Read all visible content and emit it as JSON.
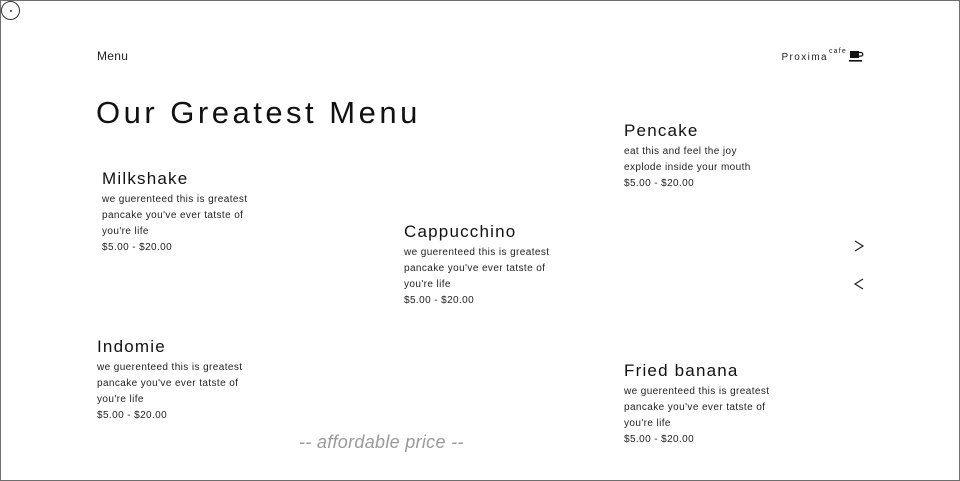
{
  "nav": {
    "menu_label": "Menu",
    "brand_name": "Proxima",
    "brand_suffix": "cafe",
    "brand_icon": "coffee-cup-icon"
  },
  "title": "Our Greatest Menu",
  "items": [
    {
      "name": "Pencake",
      "desc_lines": [
        "eat this and feel the joy",
        "explode inside your mouth"
      ],
      "price": "$5.00 - $20.00"
    },
    {
      "name": "Milkshake",
      "desc_lines": [
        "we guerenteed this is greatest",
        "pancake you've ever tatste of",
        "you're life"
      ],
      "price": "$5.00 - $20.00"
    },
    {
      "name": "Cappucchino",
      "desc_lines": [
        "we guerenteed this is greatest",
        "pancake you've ever tatste of",
        "you're life"
      ],
      "price": "$5.00 - $20.00"
    },
    {
      "name": "Indomie",
      "desc_lines": [
        "we guerenteed this is greatest",
        "pancake you've ever tatste of",
        "you're life"
      ],
      "price": "$5.00 - $20.00"
    },
    {
      "name": "Fried banana",
      "desc_lines": [
        "we guerenteed this is greatest",
        "pancake you've ever tatste of",
        "you're life"
      ],
      "price": "$5.00 - $20.00"
    }
  ],
  "controls": {
    "next_icon": "chevron-right-icon",
    "prev_icon": "chevron-left-icon"
  },
  "tagline": "-- affordable price --"
}
